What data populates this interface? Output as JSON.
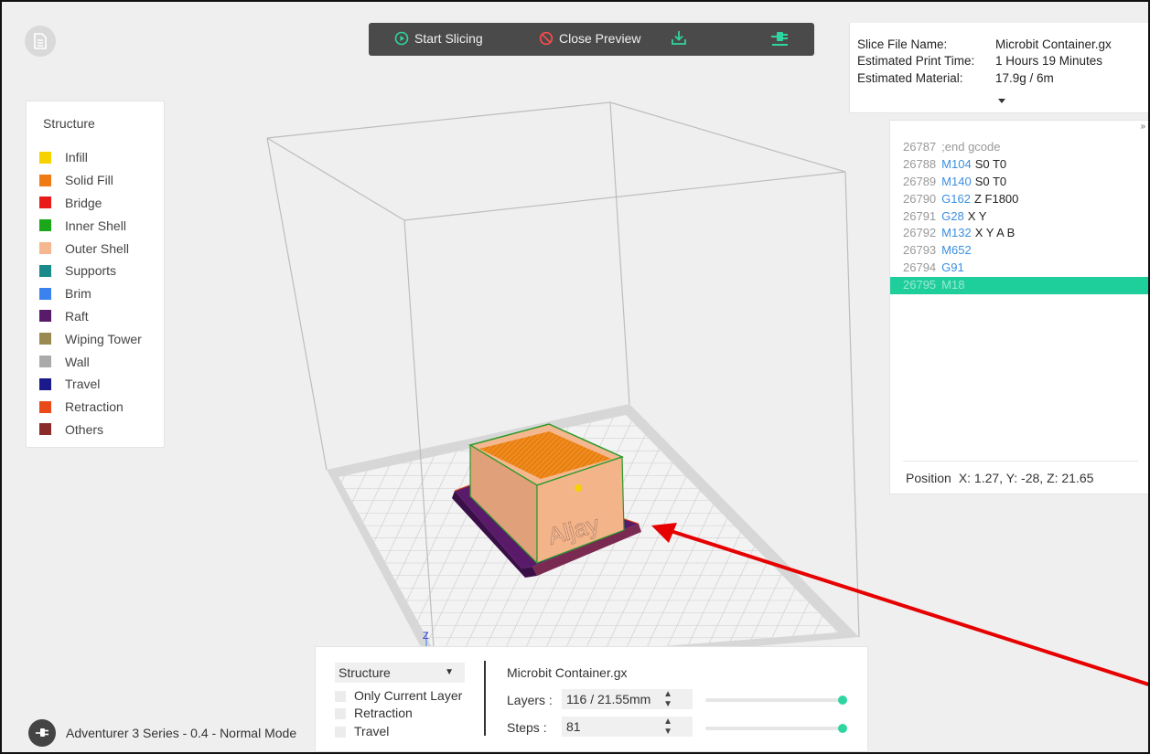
{
  "toolbar": {
    "start_slicing": "Start Slicing",
    "close_preview": "Close Preview"
  },
  "legend": {
    "title": "Structure",
    "items": [
      {
        "label": "Infill",
        "color": "#f5d200"
      },
      {
        "label": "Solid Fill",
        "color": "#f07a14"
      },
      {
        "label": "Bridge",
        "color": "#e81a1a"
      },
      {
        "label": "Inner Shell",
        "color": "#1aa81a"
      },
      {
        "label": "Outer Shell",
        "color": "#f5b78f"
      },
      {
        "label": "Supports",
        "color": "#1a8a8a"
      },
      {
        "label": "Brim",
        "color": "#3a82f0"
      },
      {
        "label": "Raft",
        "color": "#5a1a6a"
      },
      {
        "label": "Wiping Tower",
        "color": "#9a8a52"
      },
      {
        "label": "Wall",
        "color": "#aaaaaa"
      },
      {
        "label": "Travel",
        "color": "#1a1a8a"
      },
      {
        "label": "Retraction",
        "color": "#e84a1a"
      },
      {
        "label": "Others",
        "color": "#8a2a2a"
      }
    ]
  },
  "slice_info": {
    "file_name_label": "Slice File Name:",
    "file_name": "Microbit Container.gx",
    "print_time_label": "Estimated Print Time:",
    "print_time": "1 Hours 19 Minutes",
    "material_label": "Estimated Material:",
    "material": "17.9g / 6m"
  },
  "gcode": {
    "expand_symbol": "»",
    "lines": [
      {
        "num": "26787",
        "cmd": "",
        "args": "",
        "comment": ";end gcode"
      },
      {
        "num": "26788",
        "cmd": "M104",
        "args": "S0 T0",
        "comment": ""
      },
      {
        "num": "26789",
        "cmd": "M140",
        "args": "S0 T0",
        "comment": ""
      },
      {
        "num": "26790",
        "cmd": "G162",
        "args": "Z F1800",
        "comment": ""
      },
      {
        "num": "26791",
        "cmd": "G28",
        "args": "X Y",
        "comment": ""
      },
      {
        "num": "26792",
        "cmd": "M132",
        "args": "X Y A B",
        "comment": ""
      },
      {
        "num": "26793",
        "cmd": "M652",
        "args": "",
        "comment": ""
      },
      {
        "num": "26794",
        "cmd": "G91",
        "args": "",
        "comment": ""
      },
      {
        "num": "26795",
        "cmd": "M18",
        "args": "",
        "comment": "",
        "active": true
      }
    ],
    "position_label": "Position",
    "position_value": "X: 1.27, Y: -28, Z: 21.65"
  },
  "bottom": {
    "mode_select": "Structure",
    "only_current_layer": "Only Current Layer",
    "retraction": "Retraction",
    "travel": "Travel",
    "file_name": "Microbit Container.gx",
    "layers_label": "Layers :",
    "layers_value": "116 / 21.55mm",
    "layers_fraction": 1.0,
    "steps_label": "Steps :",
    "steps_value": "81",
    "steps_fraction": 1.0
  },
  "scene": {
    "model_text": "Aljay",
    "axis_label": "Z"
  },
  "status": {
    "printer": "Adventurer 3 Series - 0.4 - Normal Mode"
  },
  "annotation_color": "#e60000"
}
